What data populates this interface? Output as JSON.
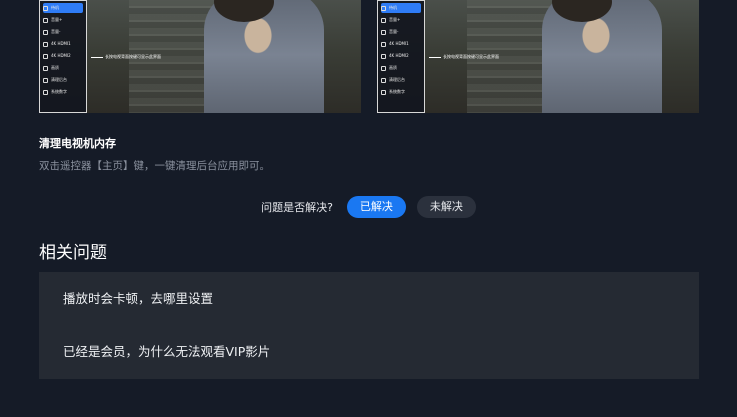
{
  "illustration": {
    "menu_items": [
      {
        "icon": "power-icon",
        "label": "待机",
        "active": true
      },
      {
        "icon": "volume-up-icon",
        "label": "音量+"
      },
      {
        "icon": "volume-down-icon",
        "label": "音量-"
      },
      {
        "icon": "hdmi-icon",
        "label": "4K HDMI1"
      },
      {
        "icon": "hdmi-icon",
        "label": "4K HDMI2"
      },
      {
        "icon": "chart-icon",
        "label": "画质"
      },
      {
        "icon": "shield-icon",
        "label": "清理后台"
      },
      {
        "icon": "settings-icon",
        "label": "系统数字"
      }
    ],
    "callout_text": "长按电视背面按键可显示此界面"
  },
  "tip": {
    "title": "清理电视机内存",
    "description": "双击遥控器【主页】键，一键清理后台应用即可。"
  },
  "feedback": {
    "question": "问题是否解决?",
    "resolved_label": "已解决",
    "unresolved_label": "未解决"
  },
  "related": {
    "title": "相关问题",
    "items": [
      {
        "label": "播放时会卡顿，去哪里设置"
      },
      {
        "label": "已经是会员，为什么无法观看VIP影片"
      }
    ]
  },
  "colors": {
    "background": "#151b27",
    "accent": "#1a78f2",
    "card": "#252a33",
    "muted_text": "#8a919e"
  }
}
